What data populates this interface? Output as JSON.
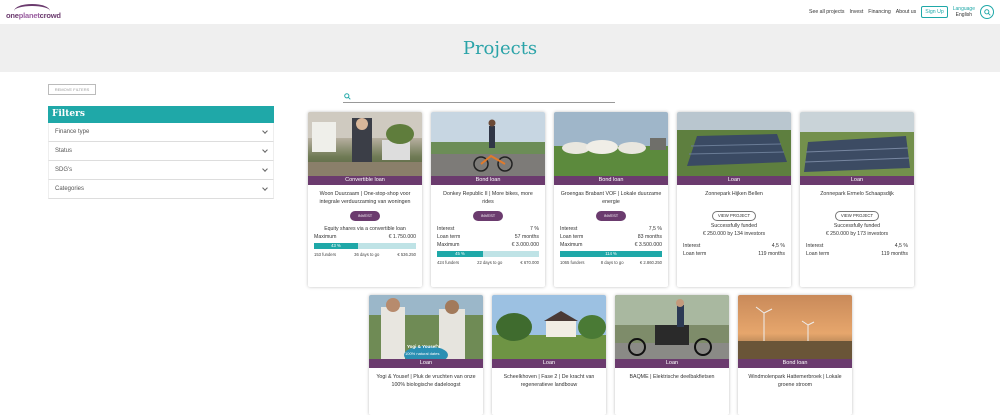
{
  "header": {
    "logo": {
      "one": "one",
      "planet": "planet",
      "crowd": "crowd"
    },
    "nav": [
      "See all projects",
      "Invest",
      "Financing",
      "About us"
    ],
    "signup": "Sign Up",
    "language_label": "Language",
    "language_value": "English"
  },
  "banner": {
    "title": "Projects"
  },
  "filters": {
    "remove_label": "REMOVE FILTERS",
    "title": "Filters",
    "items": [
      "Finance type",
      "Status",
      "SDG's",
      "Categories"
    ]
  },
  "cards": [
    {
      "type": "Convertible loan",
      "title": "Woon Duurzaam | One-stop-shop voor integrale verduurzaming van woningen",
      "button": "INVEST",
      "desc": "Equity shares via a convertible loan",
      "maximum_label": "Maximum",
      "maximum": "€ 1.750.000",
      "progress": 43,
      "progress_label": "43 %",
      "funders": "153 funders",
      "days": "36 days to go",
      "amount": "€ 536.250"
    },
    {
      "type": "Bond loan",
      "title": "Donkey Republic II | More bikes, more rides",
      "button": "INVEST",
      "interest_label": "Interest",
      "interest": "7 %",
      "term_label": "Loan term",
      "term": "57 months",
      "maximum_label": "Maximum",
      "maximum": "€ 3.000.000",
      "progress": 45,
      "progress_label": "45 %",
      "funders": "424 funders",
      "days": "22 days to go",
      "amount": "€ 670.000"
    },
    {
      "type": "Bond loan",
      "title": "Groengas Brabant VOF | Lokale duurzame energie",
      "button": "INVEST",
      "interest_label": "Interest",
      "interest": "7,5 %",
      "term_label": "Loan term",
      "term": "83 months",
      "maximum_label": "Maximum",
      "maximum": "€ 3.500.000",
      "progress": 100,
      "progress_label": "114 %",
      "funders": "1065 funders",
      "days": "8 days to go",
      "amount": "€ 2.860.250"
    },
    {
      "type": "Loan",
      "title": "Zonnepark Hijken Bellen",
      "button": "VIEW PROJECT",
      "funded": "Successfully funded",
      "funded_detail": "€ 250.000 by 134 investors",
      "interest_label": "Interest",
      "interest": "4,5 %",
      "term_label": "Loan term",
      "term": "119 months"
    },
    {
      "type": "Loan",
      "title": "Zonnepark Ermelo Schaapsdijk",
      "button": "VIEW PROJECT",
      "funded": "Successfully funded",
      "funded_detail": "€ 250.000 by 173 investors",
      "interest_label": "Interest",
      "interest": "4,5 %",
      "term_label": "Loan term",
      "term": "119 months"
    },
    {
      "type": "Loan",
      "title": "Yogi & Yousef | Pluk de vruchten van onze 100% biologische dadeloogst",
      "badge_line1": "Yogi & Yousef's",
      "badge_line2": "100% natural dates"
    },
    {
      "type": "Loan",
      "title": "Scheelkhoven | Fase 2 | De kracht van regeneratieve landbouw"
    },
    {
      "type": "Loan",
      "title": "BAQME | Elektrische deelbakfietsen"
    },
    {
      "type": "Bond loan",
      "title": "Windmolenpark Hattemerbroek | Lokale groene stroom"
    }
  ],
  "colors": {
    "teal": "#1fa8a8",
    "purple": "#6b3b6e",
    "banner_bg": "#efefef"
  }
}
